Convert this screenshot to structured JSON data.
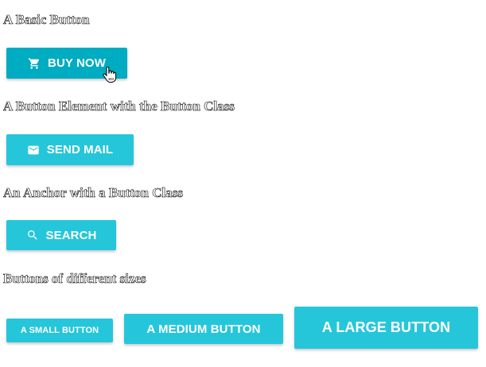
{
  "colors": {
    "button_primary": "#26c6da",
    "button_hover": "#00acc1",
    "heading_text": "#111111"
  },
  "sections": {
    "basic": {
      "heading": "A Basic Button",
      "button_label": "BUY NOW",
      "button_icon": "shopping-cart-icon",
      "state": "hover"
    },
    "button_element": {
      "heading": "A Button Element with the Button Class",
      "button_label": "SEND MAIL",
      "button_icon": "envelope-icon"
    },
    "anchor": {
      "heading": "An Anchor with a Button Class",
      "button_label": "SEARCH",
      "button_icon": "search-icon"
    },
    "sizes": {
      "heading": "Buttons of different sizes",
      "small_label": "A SMALL BUTTON",
      "medium_label": "A MEDIUM BUTTON",
      "large_label": "A LARGE BUTTON"
    }
  },
  "cursor": "hand-pointer-icon"
}
